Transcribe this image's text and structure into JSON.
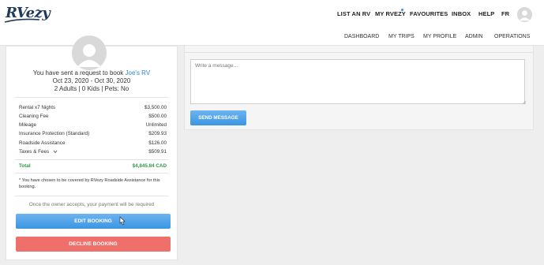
{
  "brand": {
    "logo_text": "RVezy"
  },
  "topnav": {
    "items": [
      {
        "label": "LIST AN RV"
      },
      {
        "label": "MY RVEZY"
      },
      {
        "label": "FAVOURITES"
      },
      {
        "label": "INBOX"
      },
      {
        "label": "HELP"
      },
      {
        "label": "FR"
      }
    ]
  },
  "subnav": {
    "items": [
      {
        "label": "DASHBOARD"
      },
      {
        "label": "MY TRIPS"
      },
      {
        "label": "MY PROFILE"
      },
      {
        "label": "ADMIN"
      },
      {
        "label": "OPERATIONS"
      }
    ]
  },
  "booking": {
    "request_prefix": "You have sent a request to book",
    "rv_name": "Joe's RV",
    "dates": "Oct 23, 2020 - Oct 30, 2020",
    "guests": "2 Adults | 0 Kids | Pets: No",
    "fees": [
      {
        "label": "Rental x7 Nights",
        "value": "$3,500.00"
      },
      {
        "label": "Cleaning Fee",
        "value": "$500.00"
      },
      {
        "label": "Mileage",
        "value": "Unlimited"
      },
      {
        "label": "Insurance Protection (Standard)",
        "value": "$209.93"
      },
      {
        "label": "Roadside Assistance",
        "value": "$126.00"
      },
      {
        "label": "Taxes & Fees",
        "value": "$509.91"
      }
    ],
    "total": {
      "label": "Total",
      "value": "$4,845.84 CAD"
    },
    "note": "* You have chosen to be covered by RVezy Roadside Assistance for this booking.",
    "owner_note": "Once the owner accepts, your payment will be required",
    "edit_button": "EDIT BOOKING",
    "decline_button": "DECLINE BOOKING"
  },
  "message": {
    "placeholder": "Write a message...",
    "send_button": "SEND MESSAGE"
  },
  "colors": {
    "accent_blue": "#3b95e3",
    "link_blue": "#2a86d8",
    "total_green": "#2e9a45",
    "decline_red": "#ef6f6a",
    "notification_dot": "#3a8ee6"
  }
}
